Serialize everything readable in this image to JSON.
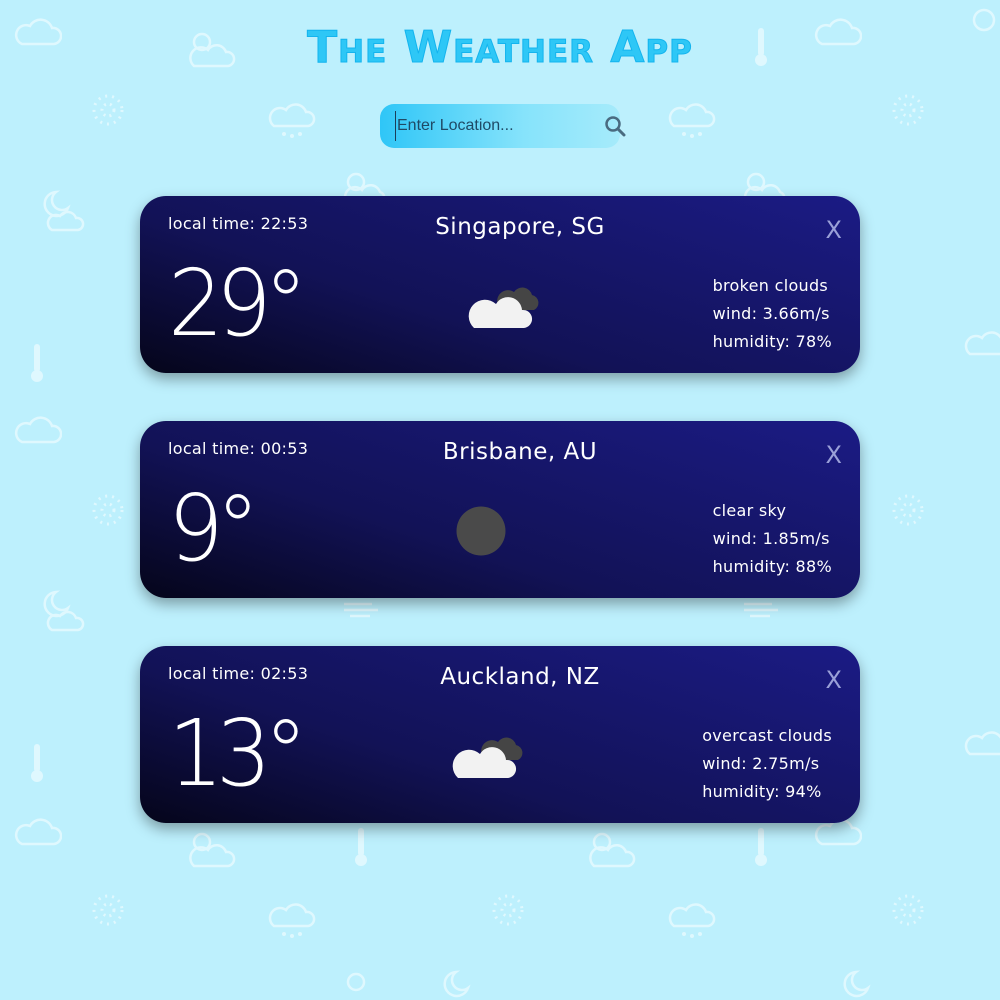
{
  "header": {
    "title": "The Weather App"
  },
  "search": {
    "placeholder": "Enter Location...",
    "value": ""
  },
  "cards": [
    {
      "local_time": "local time: 22:53",
      "city": "Singapore, SG",
      "temperature": "29°",
      "condition": "broken clouds",
      "wind": "wind: 3.66m/s",
      "humidity": "humidity: 78%",
      "close_label": "X",
      "icon": "broken-clouds-icon"
    },
    {
      "local_time": "local time: 00:53",
      "city": "Brisbane, AU",
      "temperature": "9°",
      "condition": "clear sky",
      "wind": "wind: 1.85m/s",
      "humidity": "humidity: 88%",
      "close_label": "X",
      "icon": "clear-sky-night-icon"
    },
    {
      "local_time": "local time: 02:53",
      "city": "Auckland, NZ",
      "temperature": "13°",
      "condition": "overcast clouds",
      "wind": "wind: 2.75m/s",
      "humidity": "humidity: 94%",
      "close_label": "X",
      "icon": "overcast-clouds-icon"
    }
  ],
  "colors": {
    "background": "#bdf0fd",
    "title": "#2ec7f6",
    "card_dark": "#05051a",
    "card_light": "#1b1b85"
  }
}
